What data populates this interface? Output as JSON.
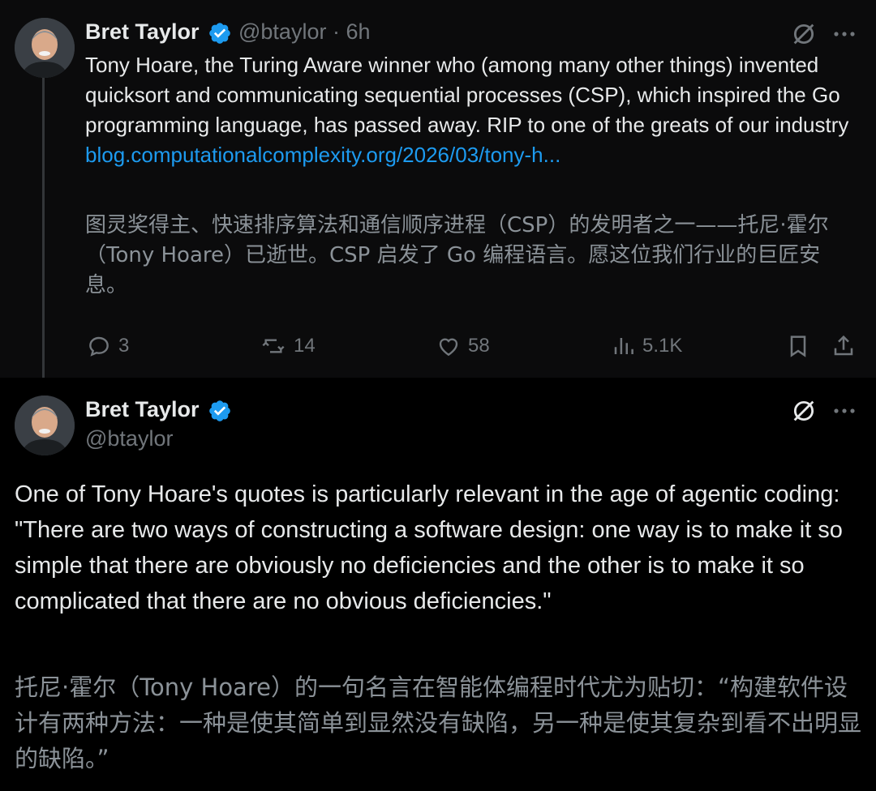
{
  "tweet1": {
    "author_name": "Bret Taylor",
    "handle": "@btaylor",
    "time": "6h",
    "text": "Tony Hoare, the Turing Aware winner who (among many other things) invented quicksort and communicating sequential processes (CSP), which inspired the Go programming language, has passed away. RIP to one of the greats of our industry ",
    "link": "blog.computationalcomplexity.org/2026/03/tony-h...",
    "translation": "图灵奖得主、快速排序算法和通信顺序进程（CSP）的发明者之一——托尼·霍尔（Tony Hoare）已逝世。CSP 启发了 Go 编程语言。愿这位我们行业的巨匠安息。",
    "actions": {
      "replies": "3",
      "reposts": "14",
      "likes": "58",
      "views": "5.1K"
    }
  },
  "tweet2": {
    "author_name": "Bret Taylor",
    "handle": "@btaylor",
    "text": "One of Tony Hoare's quotes is particularly relevant in the age of agentic coding: \"There are two ways of constructing a software design: one way is to make it so simple that there are obviously no deficiencies and the other is to make it so complicated that there are no obvious deficiencies.\"",
    "translation": "托尼·霍尔（Tony Hoare）的一句名言在智能体编程时代尤为贴切：“构建软件设计有两种方法：一种是使其简单到显然没有缺陷，另一种是使其复杂到看不出明显的缺陷。”"
  },
  "colors": {
    "link": "#1d9bf0",
    "verified": "#1d9bf0",
    "muted": "#71767b",
    "text": "#e7e9ea"
  },
  "icons": [
    "verified-badge-icon",
    "grok-icon",
    "more-icon",
    "reply-icon",
    "repost-icon",
    "like-icon",
    "views-icon",
    "bookmark-icon",
    "share-icon"
  ]
}
